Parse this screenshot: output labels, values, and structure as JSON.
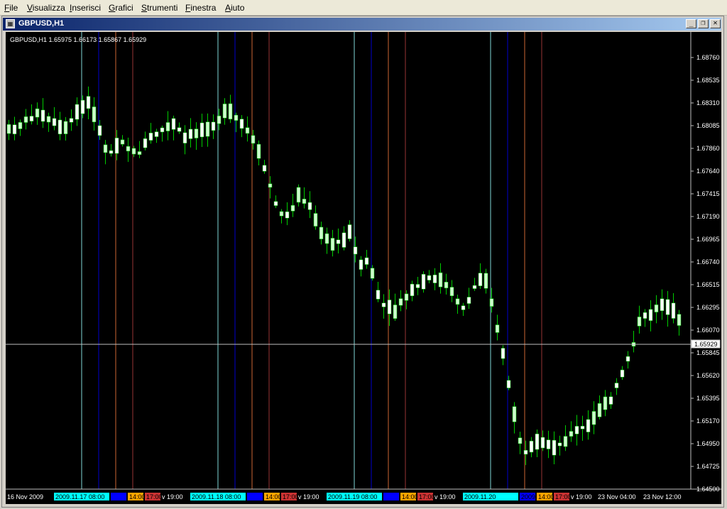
{
  "menu": [
    "File",
    "Visualizza",
    "Inserisci",
    "Grafici",
    "Strumenti",
    "Finestra",
    "Aiuto"
  ],
  "window": {
    "title": "GBPUSD,H1",
    "icon": "chart-window-icon",
    "controls": {
      "minimize": "_",
      "restore": "❐",
      "close": "✕"
    }
  },
  "chart": {
    "info": "GBPUSD,H1  1.65975 1.66173 1.65867 1.65929",
    "price_levels": [
      "1.68760",
      "1.68535",
      "1.68310",
      "1.68085",
      "1.67860",
      "1.67640",
      "1.67415",
      "1.67190",
      "1.66965",
      "1.66740",
      "1.66515",
      "1.66295",
      "1.66070",
      "1.65845",
      "1.65620",
      "1.65395",
      "1.65170",
      "1.64950",
      "1.64725",
      "1.64500"
    ],
    "current_price": "1.65929",
    "time_labels": [
      "16 Nov 2009",
      "v 19:00",
      "v 19:00",
      "v 19:00",
      "v 19:00",
      "23 Nov 04:00",
      "23 Nov 12:00"
    ],
    "session_days": [
      {
        "date": "2009.11.17 08:00",
        "t1": "",
        "t2": "14:00",
        "t3": "17:00"
      },
      {
        "date": "2009.11.18 08:00",
        "t1": "",
        "t2": "14:00",
        "t3": "17:00"
      },
      {
        "date": "2009.11.19 08:00",
        "t1": "",
        "t2": "14:00",
        "t3": "17:00"
      },
      {
        "date": "2009.11.20",
        "t1": "2009.11.20",
        "t2": "14:00",
        "t3": "17:00"
      }
    ],
    "colors": {
      "background": "#000000",
      "bull": "#ccffcc",
      "bear": "#ffffff",
      "wick": "#00cc00",
      "cyan_line": "#7fd8d8",
      "blue_line": "#0000cc",
      "orange_line": "#cc6633",
      "red_line": "#993333",
      "hline": "#c0c0c0"
    }
  }
}
